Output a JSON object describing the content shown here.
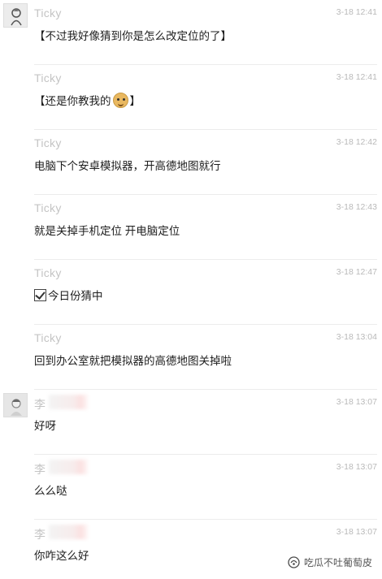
{
  "messages": [
    {
      "sender": "Ticky",
      "time": "3-18 12:41",
      "text": "【不过我好像猜到你是怎么改定位的了】",
      "show_avatar": true
    },
    {
      "sender": "Ticky",
      "time": "3-18 12:41",
      "text_before": "【还是你教我的",
      "emoji": "doge-icon",
      "text_after": "】",
      "show_avatar": false
    },
    {
      "sender": "Ticky",
      "time": "3-18 12:42",
      "text": "电脑下个安卓模拟器，开高德地图就行",
      "show_avatar": false
    },
    {
      "sender": "Ticky",
      "time": "3-18 12:43",
      "text": "就是关掉手机定位 开电脑定位",
      "show_avatar": false
    },
    {
      "sender": "Ticky",
      "time": "3-18 12:47",
      "text": "今日份猜中",
      "prefix_icon": "checkbox-icon",
      "show_avatar": false
    },
    {
      "sender": "Ticky",
      "time": "3-18 13:04",
      "text": "回到办公室就把模拟器的高德地图关掉啦",
      "show_avatar": false
    },
    {
      "sender": "李",
      "time": "3-18 13:07",
      "text": "好呀",
      "show_avatar": true
    },
    {
      "sender": "李",
      "time": "3-18 13:07",
      "text": "么么哒",
      "show_avatar": false
    },
    {
      "sender": "李",
      "time": "3-18 13:07",
      "text": "你咋这么好",
      "show_avatar": false
    }
  ],
  "watermark": {
    "text": "吃瓜不吐葡萄皮",
    "icon": "wechat-channel-icon"
  }
}
